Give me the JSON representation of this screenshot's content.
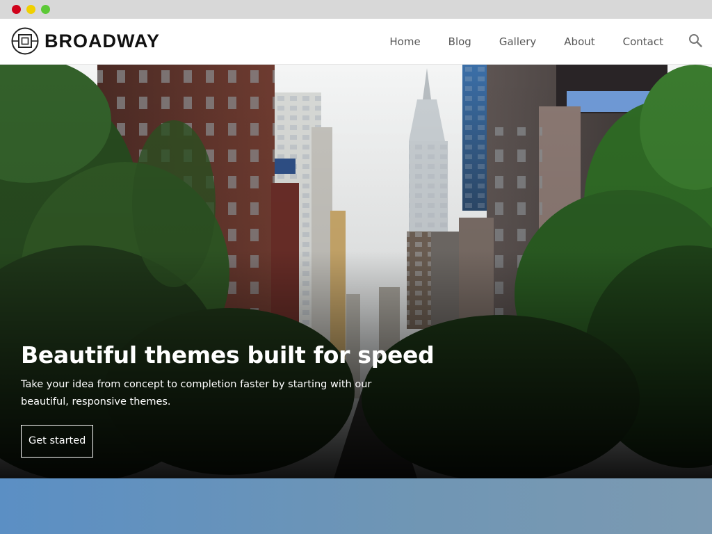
{
  "window": {
    "controls": [
      "close",
      "minimize",
      "maximize"
    ],
    "colors": {
      "close": "#d0021b",
      "minimize": "#f0d000",
      "maximize": "#5cc936"
    }
  },
  "header": {
    "logo_icon": "square-target-logo-icon",
    "brand": "BROADWAY",
    "nav": [
      {
        "label": "Home"
      },
      {
        "label": "Blog"
      },
      {
        "label": "Gallery"
      },
      {
        "label": "About"
      },
      {
        "label": "Contact"
      }
    ],
    "search_icon": "search-icon"
  },
  "hero": {
    "title": "Beautiful themes built for speed",
    "subtitle": "Take your idea from concept to completion faster by starting with our beautiful, responsive themes.",
    "cta": "Get started",
    "background": "city-avenue-with-skyscrapers-and-trees"
  },
  "colors": {
    "brand_text": "#111111",
    "nav_text": "#555555",
    "hero_text": "#ffffff",
    "below_section": "#6a93bb"
  }
}
